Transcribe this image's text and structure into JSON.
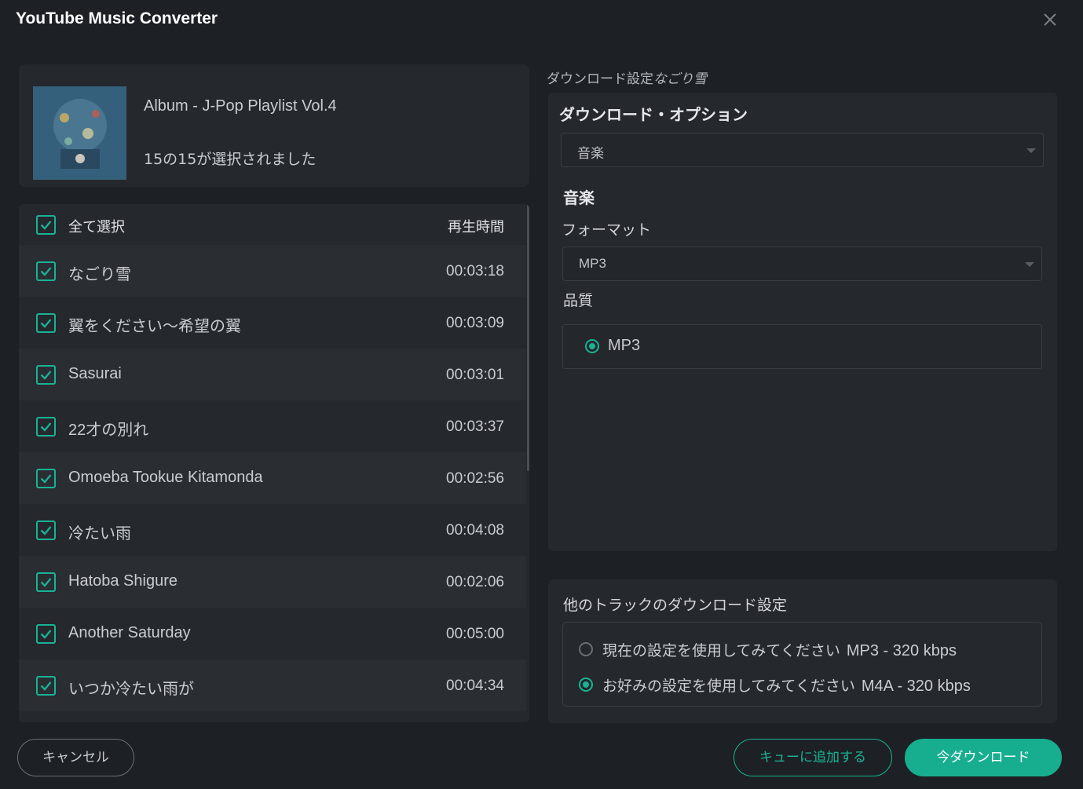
{
  "window": {
    "title": "YouTube Music Converter"
  },
  "album": {
    "title": "Album - J-Pop Playlist Vol.4",
    "selected_text": "15の15が選択されました"
  },
  "tracklist": {
    "select_all_label": "全て選択",
    "duration_header": "再生時間",
    "tracks": [
      {
        "name": "なごり雪",
        "duration": "00:03:18",
        "checked": true
      },
      {
        "name": "翼をください～希望の翼",
        "duration": "00:03:09",
        "checked": true
      },
      {
        "name": "Sasurai",
        "duration": "00:03:01",
        "checked": true
      },
      {
        "name": "22才の別れ",
        "duration": "00:03:37",
        "checked": true
      },
      {
        "name": "Omoeba Tookue Kitamonda",
        "duration": "00:02:56",
        "checked": true
      },
      {
        "name": "冷たい雨",
        "duration": "00:04:08",
        "checked": true
      },
      {
        "name": "Hatoba Shigure",
        "duration": "00:02:06",
        "checked": true
      },
      {
        "name": "Another Saturday",
        "duration": "00:05:00",
        "checked": true
      },
      {
        "name": "いつか冷たい雨が",
        "duration": "00:04:34",
        "checked": true
      }
    ]
  },
  "settings": {
    "caption_prefix": "ダウンロード設定",
    "caption_track": "なごり雪",
    "options_title": "ダウンロード・オプション",
    "option_value": "音楽",
    "music_section": "音楽",
    "format_label": "フォーマット",
    "format_value": "MP3",
    "quality_label": "品質",
    "quality_option": "MP3"
  },
  "other_tracks": {
    "title": "他のトラックのダウンロード設定",
    "options": [
      {
        "label": "現在の設定を使用してみてください",
        "tag": "MP3 - 320 kbps",
        "selected": false
      },
      {
        "label": "お好みの設定を使用してみてください",
        "tag": "M4A - 320 kbps",
        "selected": true
      }
    ]
  },
  "buttons": {
    "cancel": "キャンセル",
    "add_to_queue": "キューに追加する",
    "download_now": "今ダウンロード"
  },
  "colors": {
    "accent": "#19b394",
    "background": "#1d2024",
    "panel": "#25282d"
  }
}
